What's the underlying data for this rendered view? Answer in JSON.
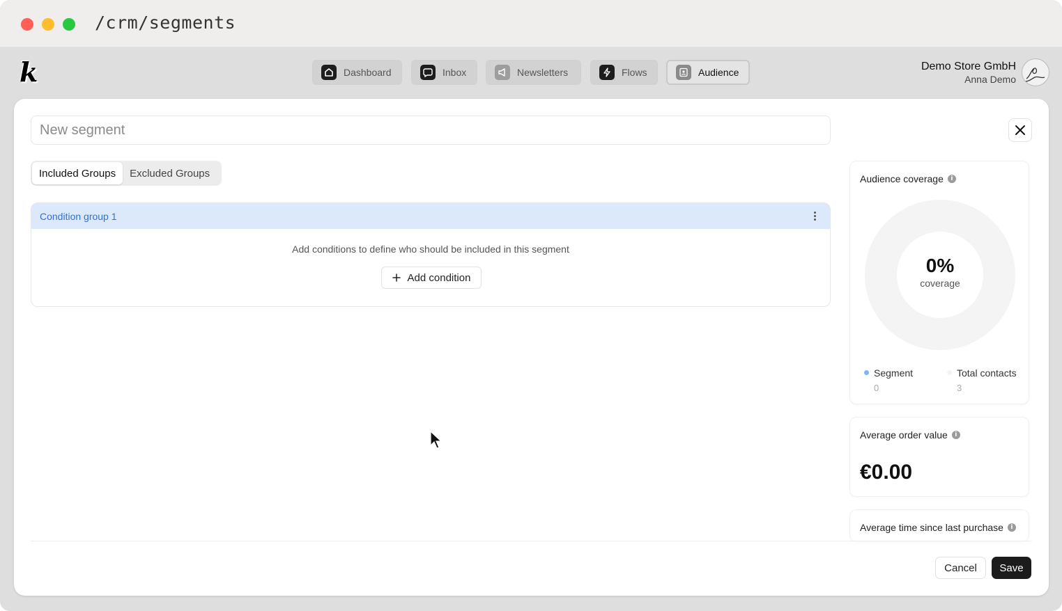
{
  "browser": {
    "url": "/crm/segments"
  },
  "app": {
    "logo": "k"
  },
  "nav": [
    {
      "label": "Dashboard",
      "icon": "home-icon"
    },
    {
      "label": "Inbox",
      "icon": "chat-bubble-icon"
    },
    {
      "label": "Newsletters",
      "icon": "megaphone-icon"
    },
    {
      "label": "Flows",
      "icon": "lightning-icon"
    },
    {
      "label": "Audience",
      "icon": "contacts-icon",
      "active": true
    }
  ],
  "account": {
    "store": "Demo Store GmbH",
    "user": "Anna Demo"
  },
  "segment": {
    "name_placeholder": "New segment",
    "name_value": ""
  },
  "tabs": [
    {
      "label": "Included Groups",
      "active": true
    },
    {
      "label": "Excluded Groups",
      "active": false
    }
  ],
  "group": {
    "title": "Condition group 1",
    "help": "Add conditions to define who should be included in this segment",
    "add_label": "Add condition"
  },
  "stats": {
    "coverage": {
      "label": "Audience coverage",
      "percent": "0%",
      "caption": "coverage",
      "segment_label": "Segment",
      "segment_value": "0",
      "total_label": "Total contacts",
      "total_value": "3",
      "segment_color": "#5aa2f0"
    },
    "aov": {
      "label": "Average order value",
      "value": "€0.00"
    },
    "time_since": {
      "label": "Average time since last purchase"
    }
  },
  "actions": {
    "cancel": "Cancel",
    "save": "Save"
  }
}
